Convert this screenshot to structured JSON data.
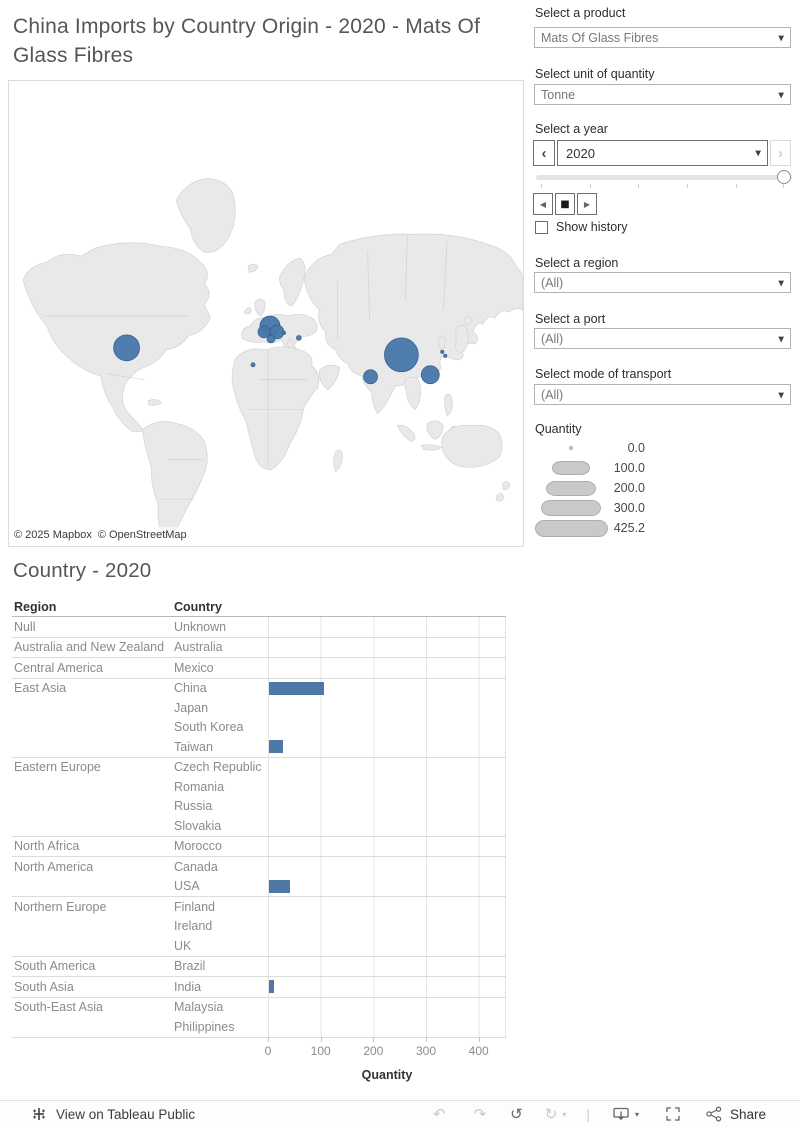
{
  "title": "China Imports by Country Origin - 2020 - Mats Of Glass Fibres",
  "map": {
    "attribution_mapbox": "© 2025 Mapbox",
    "attribution_osm": "© OpenStreetMap",
    "bubble_color": "#4878aa",
    "bubbles": [
      {
        "name": "usa",
        "x": 118,
        "y": 268,
        "r": 13
      },
      {
        "name": "france",
        "x": 262,
        "y": 246,
        "r": 10
      },
      {
        "name": "germany",
        "x": 256,
        "y": 252,
        "r": 6
      },
      {
        "name": "italy",
        "x": 269,
        "y": 252,
        "r": 7
      },
      {
        "name": "spain",
        "x": 263,
        "y": 259,
        "r": 4
      },
      {
        "name": "belgium-dot",
        "x": 276,
        "y": 253,
        "r": 1.6
      },
      {
        "name": "romania-dot",
        "x": 291,
        "y": 258,
        "r": 2.4
      },
      {
        "name": "morocco-dot",
        "x": 245,
        "y": 285,
        "r": 2
      },
      {
        "name": "china",
        "x": 394,
        "y": 275,
        "r": 17
      },
      {
        "name": "india",
        "x": 363,
        "y": 297,
        "r": 7
      },
      {
        "name": "south-china",
        "x": 423,
        "y": 295,
        "r": 9
      },
      {
        "name": "south-korea-dot",
        "x": 435,
        "y": 272,
        "r": 1.6
      },
      {
        "name": "japan-dot",
        "x": 438,
        "y": 276,
        "r": 1.6
      }
    ]
  },
  "filters": {
    "product": {
      "label": "Select a product",
      "value": "Mats Of Glass Fibres"
    },
    "unit": {
      "label": "Select unit of quantity",
      "value": "Tonne"
    },
    "year": {
      "label": "Select a year",
      "value": "2020",
      "prev": "‹",
      "next": "›"
    },
    "playback": {
      "back": "◀",
      "stop": "■",
      "forward": "▶"
    },
    "show_history_label": "Show history",
    "region": {
      "label": "Select a region",
      "value": "(All)"
    },
    "port": {
      "label": "Select a port",
      "value": "(All)"
    },
    "transport": {
      "label": "Select mode of transport",
      "value": "(All)"
    }
  },
  "size_legend": {
    "title": "Quantity",
    "items": [
      {
        "label": "0.0",
        "w": 4,
        "h": 4
      },
      {
        "label": "100.0",
        "w": 38,
        "h": 14
      },
      {
        "label": "200.0",
        "w": 50,
        "h": 15
      },
      {
        "label": "300.0",
        "w": 60,
        "h": 16
      },
      {
        "label": "425.2",
        "w": 73,
        "h": 17
      }
    ]
  },
  "chart_data": {
    "type": "bar",
    "title": "Country - 2020",
    "col_headers": [
      "Region",
      "Country"
    ],
    "xlabel": "Quantity",
    "x_ticks": [
      0,
      100,
      200,
      300,
      400
    ],
    "xlim": [
      0,
      450
    ],
    "bar_color": "#4e79a7",
    "grid": true,
    "groups": [
      {
        "region": "Null",
        "countries": [
          {
            "name": "Unknown",
            "value": 0
          }
        ]
      },
      {
        "region": "Australia and New Zealand",
        "countries": [
          {
            "name": "Australia",
            "value": 0
          }
        ]
      },
      {
        "region": "Central America",
        "countries": [
          {
            "name": "Mexico",
            "value": 0
          }
        ]
      },
      {
        "region": "East Asia",
        "countries": [
          {
            "name": "China",
            "value": 105
          },
          {
            "name": "Japan",
            "value": 0
          },
          {
            "name": "South Korea",
            "value": 0
          },
          {
            "name": "Taiwan",
            "value": 27
          }
        ]
      },
      {
        "region": "Eastern Europe",
        "countries": [
          {
            "name": "Czech Republic",
            "value": 0
          },
          {
            "name": "Romania",
            "value": 0
          },
          {
            "name": "Russia",
            "value": 0
          },
          {
            "name": "Slovakia",
            "value": 0
          }
        ]
      },
      {
        "region": "North Africa",
        "countries": [
          {
            "name": "Morocco",
            "value": 0
          }
        ]
      },
      {
        "region": "North America",
        "countries": [
          {
            "name": "Canada",
            "value": 0
          },
          {
            "name": "USA",
            "value": 40
          }
        ]
      },
      {
        "region": "Northern Europe",
        "countries": [
          {
            "name": "Finland",
            "value": 0
          },
          {
            "name": "Ireland",
            "value": 0
          },
          {
            "name": "UK",
            "value": 0
          }
        ]
      },
      {
        "region": "South America",
        "countries": [
          {
            "name": "Brazil",
            "value": 0
          }
        ]
      },
      {
        "region": "South Asia",
        "countries": [
          {
            "name": "India",
            "value": 10
          }
        ]
      },
      {
        "region": "South-East Asia",
        "countries": [
          {
            "name": "Malaysia",
            "value": 0
          },
          {
            "name": "Philippines",
            "value": 0
          }
        ]
      }
    ]
  },
  "toolbar": {
    "view_label": "View on Tableau Public",
    "share_label": "Share",
    "undo": "↶",
    "redo": "↷",
    "revert": "↺",
    "refresh": "↻",
    "caret": "▾",
    "separator": "|"
  }
}
